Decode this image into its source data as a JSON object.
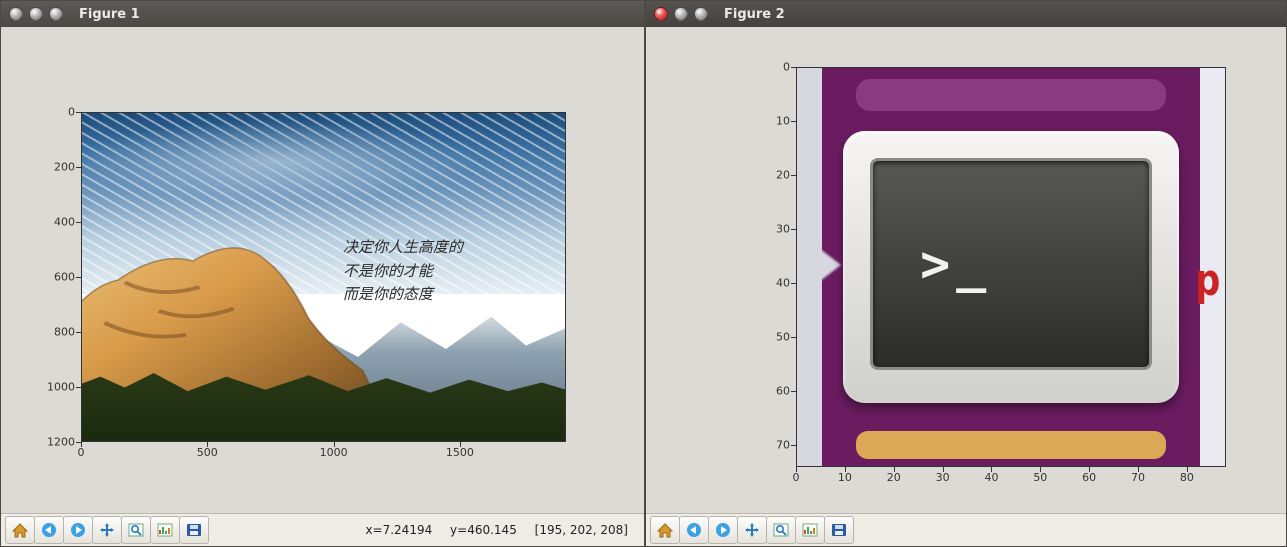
{
  "figure1": {
    "title": "Figure 1",
    "y_ticks": [
      "0",
      "200",
      "400",
      "600",
      "800",
      "1000",
      "1200"
    ],
    "y_max": 1200,
    "x_ticks": [
      "0",
      "500",
      "1000",
      "1500"
    ],
    "x_max": 1920,
    "poem": {
      "line1": "决定你人生高度的",
      "line2": "不是你的才能",
      "line3": "而是你的态度"
    },
    "status": {
      "x": "x=7.24194",
      "y": "y=460.145",
      "rgb": "[195, 202, 208]"
    }
  },
  "figure2": {
    "title": "Figure 2",
    "y_ticks": [
      "0",
      "10",
      "20",
      "30",
      "40",
      "50",
      "60",
      "70"
    ],
    "y_max": 74,
    "x_ticks": [
      "0",
      "10",
      "20",
      "30",
      "40",
      "50",
      "60",
      "70",
      "80"
    ],
    "x_max": 88,
    "terminal_prompt": ">_",
    "p_glyph": "p"
  },
  "toolbar": {
    "home": "Home",
    "back": "Back",
    "fwd": "Forward",
    "pan": "Pan",
    "zoom": "Zoom",
    "subplots": "Configure subplots",
    "save": "Save"
  },
  "chart_data": [
    {
      "type": "image",
      "title": "Figure 1",
      "description": "Photograph of sunlit mountain with wispy clouds and Chinese quotation overlay",
      "x_range": [
        0,
        1920
      ],
      "y_range": [
        0,
        1200
      ],
      "y_inverted": true,
      "pixel_sample": {
        "x": 7.24194,
        "y": 460.145,
        "rgb": [
          195,
          202,
          208
        ]
      },
      "overlay_text": [
        "决定你人生高度的",
        "不是你的才能",
        "而是你的态度"
      ]
    },
    {
      "type": "image",
      "title": "Figure 2",
      "description": "Zoomed screenshot of a terminal application icon on a purple launcher bar",
      "x_range": [
        0,
        88
      ],
      "y_range": [
        0,
        74
      ],
      "y_inverted": true
    }
  ]
}
